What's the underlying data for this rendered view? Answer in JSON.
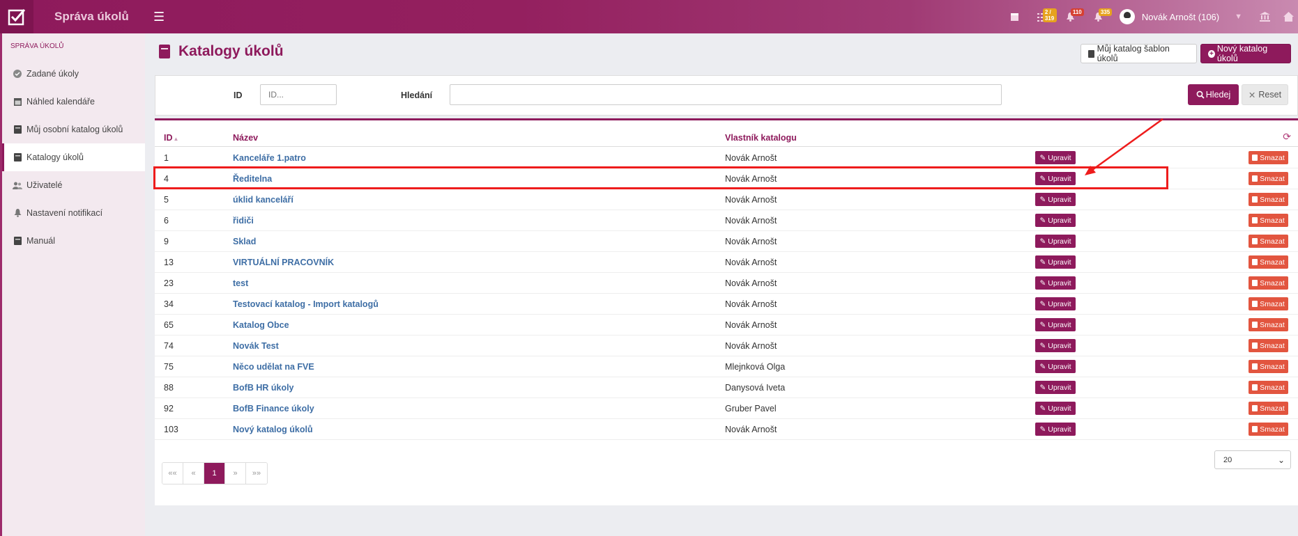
{
  "header": {
    "title": "Správa úkolů",
    "icons": [
      {
        "name": "calendar-icon",
        "badge": ""
      },
      {
        "name": "tasks-icon",
        "badge": "2 / 319"
      },
      {
        "name": "bell-icon",
        "badge": "110"
      },
      {
        "name": "bell-alert-icon",
        "badge": "335"
      }
    ],
    "user_name": "Novák Arnošt (106)"
  },
  "sidebar": {
    "section_title": "SPRÁVA ÚKOLŮ",
    "items": [
      {
        "label": "Zadané úkoly",
        "icon": "check-circle-icon"
      },
      {
        "label": "Náhled kalendáře",
        "icon": "calendar-icon"
      },
      {
        "label": "Můj osobní katalog úkolů",
        "icon": "book-icon"
      },
      {
        "label": "Katalogy úkolů",
        "icon": "book-icon",
        "active": true
      },
      {
        "label": "Uživatelé",
        "icon": "users-icon"
      },
      {
        "label": "Nastavení notifikací",
        "icon": "bell-icon"
      },
      {
        "label": "Manuál",
        "icon": "book-icon"
      }
    ]
  },
  "page": {
    "title": "Katalogy úkolů",
    "btn_my_template_catalog": "Můj katalog šablon úkolů",
    "btn_new_catalog": "Nový katalog úkolů"
  },
  "filter": {
    "id_label": "ID",
    "id_placeholder": "ID...",
    "search_label": "Hledání",
    "search_value": "",
    "search_button": "Hledej",
    "reset_button": "Reset"
  },
  "table": {
    "columns": {
      "id": "ID",
      "name": "Název",
      "owner": "Vlastník katalogu"
    },
    "edit_label": "Upravit",
    "delete_label": "Smazat",
    "rows": [
      {
        "id": "1",
        "name": "Kanceláře 1.patro",
        "owner": "Novák Arnošt"
      },
      {
        "id": "4",
        "name": "Ředitelna",
        "owner": "Novák Arnošt"
      },
      {
        "id": "5",
        "name": "úklid kanceláří",
        "owner": "Novák Arnošt"
      },
      {
        "id": "6",
        "name": "řidiči",
        "owner": "Novák Arnošt"
      },
      {
        "id": "9",
        "name": "Sklad",
        "owner": "Novák Arnošt"
      },
      {
        "id": "13",
        "name": "VIRTUÁLNÍ PRACOVNÍK",
        "owner": "Novák Arnošt"
      },
      {
        "id": "23",
        "name": "test",
        "owner": "Novák Arnošt"
      },
      {
        "id": "34",
        "name": "Testovací katalog - Import katalogů",
        "owner": "Novák Arnošt"
      },
      {
        "id": "65",
        "name": "Katalog Obce",
        "owner": "Novák Arnošt"
      },
      {
        "id": "74",
        "name": "Novák Test",
        "owner": "Novák Arnošt"
      },
      {
        "id": "75",
        "name": "Něco udělat na FVE",
        "owner": "Mlejnková Olga"
      },
      {
        "id": "88",
        "name": "BofB HR úkoly",
        "owner": "Danysová Iveta"
      },
      {
        "id": "92",
        "name": "BofB Finance úkoly",
        "owner": "Gruber Pavel"
      },
      {
        "id": "103",
        "name": "Nový katalog úkolů",
        "owner": "Novák Arnošt"
      }
    ]
  },
  "pagination": {
    "first": "««",
    "prev": "«",
    "current": "1",
    "next": "»",
    "last": "»»",
    "page_size": "20"
  },
  "colors": {
    "brand": "#8e1a5c",
    "danger": "#e2553f",
    "link": "#3e6ea5",
    "annotation": "#ee1c1c"
  }
}
